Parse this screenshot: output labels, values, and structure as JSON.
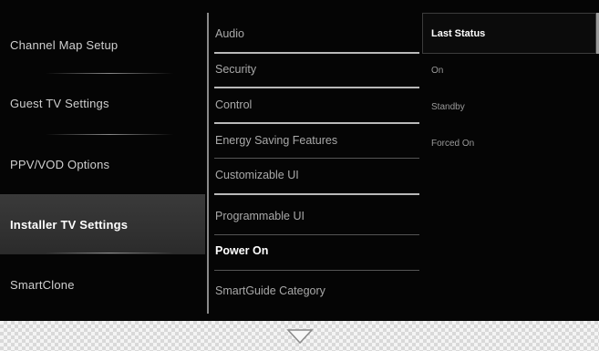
{
  "menu": {
    "level1": [
      {
        "label": "Channel Map Setup"
      },
      {
        "label": "Guest TV Settings"
      },
      {
        "label": "PPV/VOD Options"
      },
      {
        "label": "Installer TV Settings",
        "selected": true
      },
      {
        "label": "SmartClone"
      }
    ],
    "level2": [
      {
        "label": "Audio"
      },
      {
        "label": "Security"
      },
      {
        "label": "Control"
      },
      {
        "label": "Energy Saving Features"
      },
      {
        "label": "Customizable UI"
      },
      {
        "label": "Programmable UI"
      },
      {
        "label": "Power On",
        "active": true
      },
      {
        "label": "SmartGuide Category"
      }
    ],
    "level3": [
      {
        "label": "Last Status",
        "selected": true
      },
      {
        "label": "On"
      },
      {
        "label": "Standby"
      },
      {
        "label": "Forced On"
      }
    ]
  },
  "scroll_indicator": {
    "icon": "chevron-down-icon"
  }
}
